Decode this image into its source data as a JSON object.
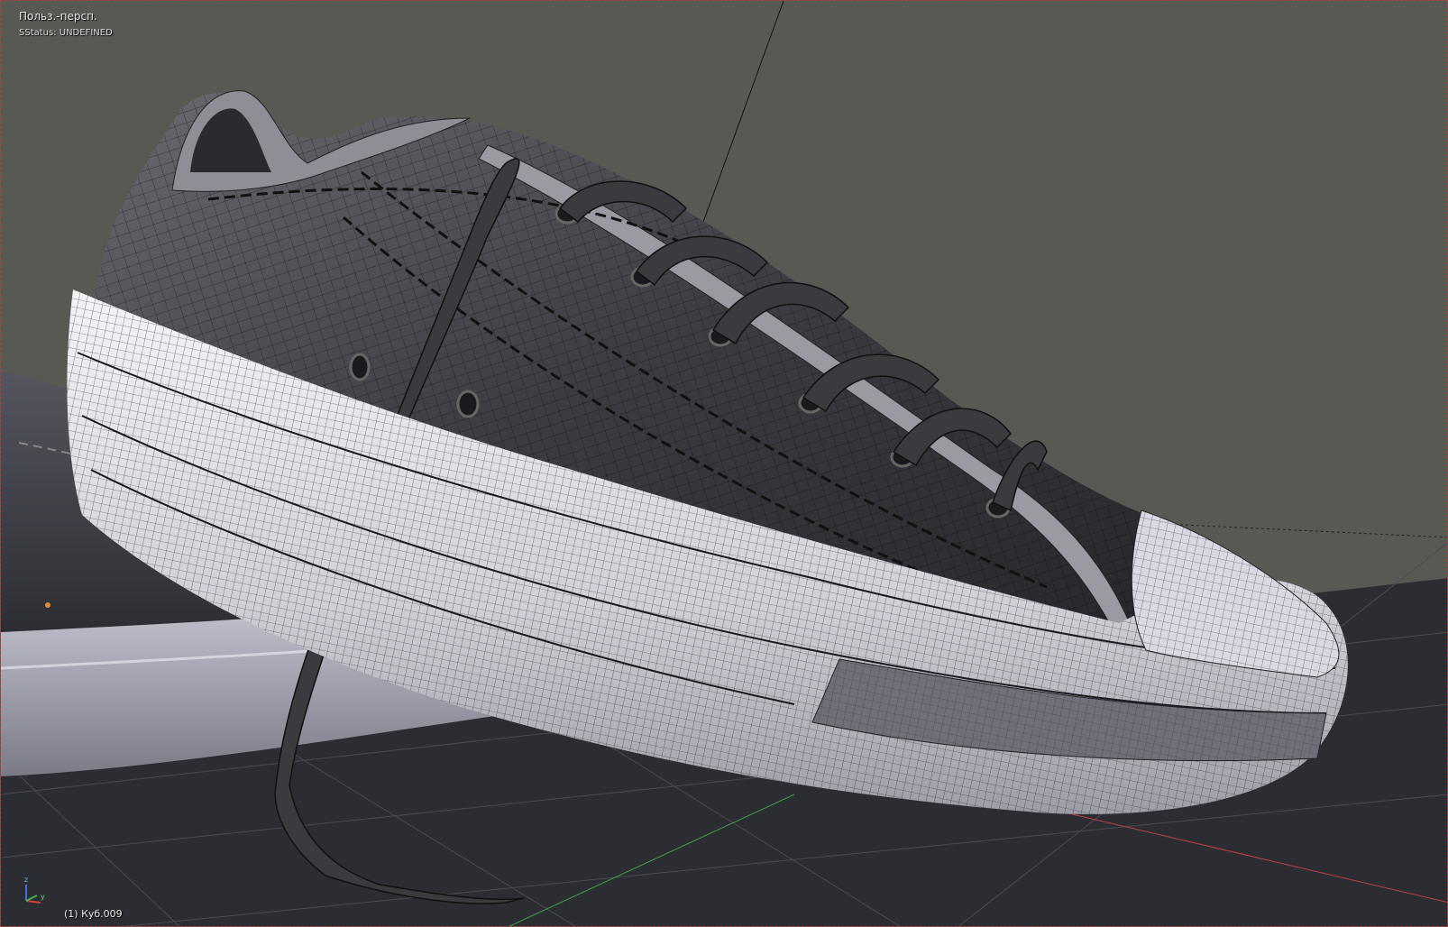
{
  "viewport": {
    "view_name": "Польз.-персп.",
    "status": "SStatus: UNDEFINED",
    "object_name": "(1) Куб.009",
    "background_color": "#595954",
    "floor_color": "#2c2d33"
  },
  "axis_gizmo": {
    "z_label": "z",
    "y_label": "y",
    "colors": {
      "x": "#d04040",
      "y": "#40b040",
      "z": "#4070e0"
    }
  },
  "scene": {
    "object": "sneaker-mesh-wireframe",
    "mesh_color": "#3a3a3e",
    "sole_color": "#e8e8ee",
    "wire_color": "#111111"
  }
}
